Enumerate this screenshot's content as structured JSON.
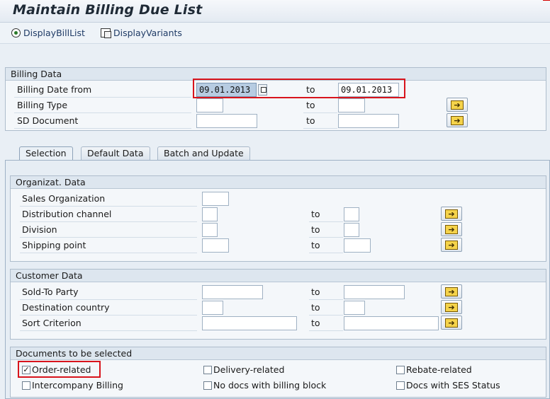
{
  "window": {
    "title": "Maintain Billing Due List"
  },
  "toolbar": {
    "display_bill_list": "DisplayBillList",
    "display_variants": "DisplayVariants"
  },
  "billing_data": {
    "header": "Billing Data",
    "rows": [
      {
        "label": "Billing Date from",
        "from": "09.01.2013",
        "to_label": "to",
        "to": "09.01.2013"
      },
      {
        "label": "Billing Type",
        "from": "",
        "to_label": "to",
        "to": ""
      },
      {
        "label": "SD Document",
        "from": "",
        "to_label": "to",
        "to": ""
      }
    ]
  },
  "tabs": [
    {
      "label": "Selection",
      "active": true
    },
    {
      "label": "Default Data",
      "active": false
    },
    {
      "label": "Batch and Update",
      "active": false
    }
  ],
  "organizational_data": {
    "header": "Organizat. Data",
    "rows": [
      {
        "label": "Sales Organization",
        "from": ""
      },
      {
        "label": "Distribution channel",
        "from": "",
        "to_label": "to",
        "to": ""
      },
      {
        "label": "Division",
        "from": "",
        "to_label": "to",
        "to": ""
      },
      {
        "label": "Shipping point",
        "from": "",
        "to_label": "to",
        "to": ""
      }
    ]
  },
  "customer_data": {
    "header": "Customer Data",
    "rows": [
      {
        "label": "Sold-To Party",
        "from": "",
        "to_label": "to",
        "to": ""
      },
      {
        "label": "Destination country",
        "from": "",
        "to_label": "to",
        "to": ""
      },
      {
        "label": "Sort Criterion",
        "from": "",
        "to_label": "to",
        "to": ""
      }
    ]
  },
  "documents": {
    "header": "Documents to be selected",
    "options": [
      {
        "label": "Order-related",
        "checked": true
      },
      {
        "label": "Delivery-related",
        "checked": false
      },
      {
        "label": "Rebate-related",
        "checked": false
      },
      {
        "label": "Intercompany Billing",
        "checked": false
      },
      {
        "label": "No docs with billing block",
        "checked": false
      },
      {
        "label": "Docs with SES Status",
        "checked": false
      }
    ]
  },
  "icons": {
    "display_bill_list": "execute-icon",
    "display_variants": "variants-icon",
    "multiple_selection": "arrow-right-icon",
    "value_help": "f4-help-icon"
  },
  "colors": {
    "highlight": "#d8141c",
    "selected_field": "#b7cce2"
  }
}
